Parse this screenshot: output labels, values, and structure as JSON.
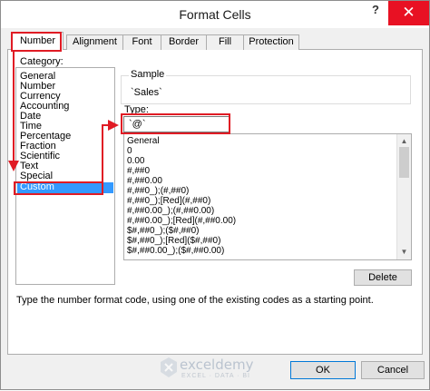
{
  "window": {
    "title": "Format Cells",
    "help_label": "?",
    "close_label": "✕"
  },
  "tabs": [
    {
      "label": "Number"
    },
    {
      "label": "Alignment"
    },
    {
      "label": "Font"
    },
    {
      "label": "Border"
    },
    {
      "label": "Fill"
    },
    {
      "label": "Protection"
    }
  ],
  "category": {
    "label": "Category:",
    "items": [
      "General",
      "Number",
      "Currency",
      "Accounting",
      "Date",
      "Time",
      "Percentage",
      "Fraction",
      "Scientific",
      "Text",
      "Special",
      "Custom"
    ],
    "selected": "Custom"
  },
  "sample": {
    "label": "Sample",
    "value": "`Sales`"
  },
  "type_field": {
    "label": "Type:",
    "value": "`@`"
  },
  "format_codes": [
    "General",
    "0",
    "0.00",
    "#,##0",
    "#,##0.00",
    "#,##0_);(#,##0)",
    "#,##0_);[Red](#,##0)",
    "#,##0.00_);(#,##0.00)",
    "#,##0.00_);[Red](#,##0.00)",
    "$#,##0_);($#,##0)",
    "$#,##0_);[Red]($#,##0)",
    "$#,##0.00_);($#,##0.00)"
  ],
  "buttons": {
    "delete": "Delete",
    "ok": "OK",
    "cancel": "Cancel"
  },
  "hint": "Type the number format code, using one of the existing codes as a starting point.",
  "watermark": {
    "name": "exceldemy",
    "tagline": "EXCEL · DATA · BI"
  },
  "colors": {
    "highlight": "#e01b24",
    "selection": "#3399ff",
    "close": "#e81123"
  }
}
